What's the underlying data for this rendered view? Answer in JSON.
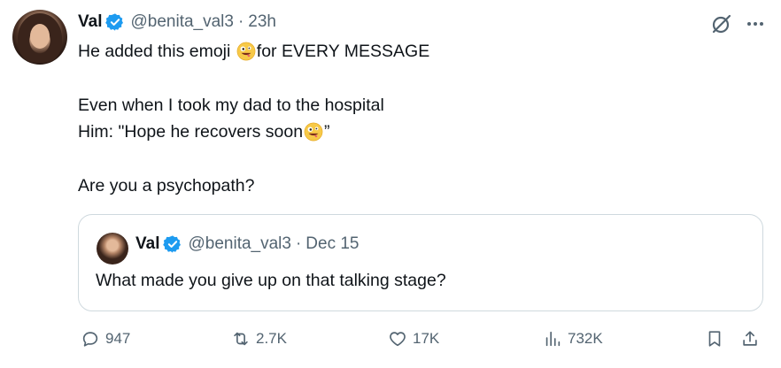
{
  "post": {
    "author_name": "Val",
    "handle": "@benita_val3",
    "separator": "·",
    "time": "23h",
    "lines": {
      "l1_a": "He added this emoji",
      "l1_b": "for EVERY MESSAGE",
      "l2": "Even when I took my dad to the hospital",
      "l3_a": "Him: \"Hope he recovers soon",
      "l3_b": "”",
      "l4": "Are you a psychopath?"
    },
    "emoji": "zany-face"
  },
  "quote": {
    "author_name": "Val",
    "handle": "@benita_val3",
    "separator": "·",
    "date": "Dec 15",
    "text": "What made you give up on that talking stage?"
  },
  "actions": {
    "replies": "947",
    "reposts": "2.7K",
    "likes": "17K",
    "views": "732K"
  },
  "colors": {
    "verified": "#1d9bf0",
    "secondary_text": "#536471",
    "border": "#cfd9de"
  },
  "icons": [
    "grok-icon",
    "more-icon",
    "reply-icon",
    "repost-icon",
    "like-icon",
    "views-icon",
    "bookmark-icon",
    "share-icon",
    "verified-icon"
  ]
}
